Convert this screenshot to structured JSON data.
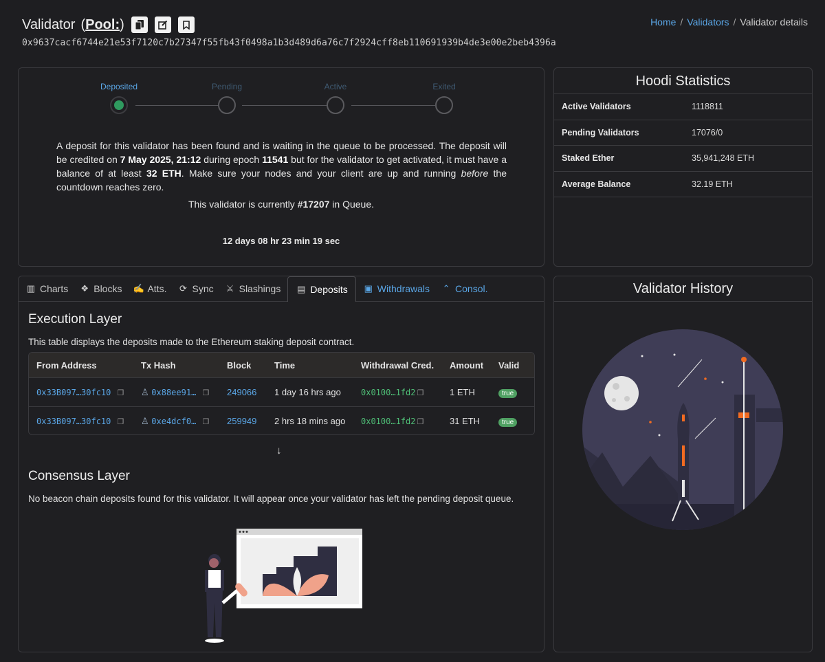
{
  "header": {
    "title": "Validator",
    "pool_prefix": "(",
    "pool_label": "Pool:",
    "pool_suffix": ")",
    "pubkey": "0x9637cacf6744e21e53f7120c7b27347f55fb43f0498a1b3d489d6a76c7f2924cff8eb110691939b4de3e00e2beb4396a"
  },
  "breadcrumb": {
    "home": "Home",
    "validators": "Validators",
    "current": "Validator details",
    "sep": "/"
  },
  "steps": [
    {
      "label": "Deposited",
      "state": "done",
      "color": "#5aa6e6"
    },
    {
      "label": "Pending",
      "state": "todo",
      "color": "#3f5a72"
    },
    {
      "label": "Active",
      "state": "todo",
      "color": "#3f5a72"
    },
    {
      "label": "Exited",
      "state": "todo",
      "color": "#3f5a72"
    }
  ],
  "status": {
    "t1": "A deposit for this validator has been found and is waiting in the queue to be processed. The deposit will be credited on ",
    "date": "7 May 2025, 21:12",
    "t2": " during epoch ",
    "epoch": "11541",
    "t3": " but for the validator to get activated, it must have a balance of at least ",
    "min_balance": "32 ETH",
    "t4": ". Make sure your nodes and your client are up and running ",
    "emph": "before",
    "t5": " the countdown reaches zero.",
    "queue_prefix": "This validator is currently ",
    "queue_pos": "#17207",
    "queue_suffix": " in Queue.",
    "countdown": "12 days 08 hr 23 min 19 sec"
  },
  "stats": {
    "title": "Hoodi Statistics",
    "rows": [
      {
        "label": "Active Validators",
        "value": "1118811"
      },
      {
        "label": "Pending Validators",
        "value": "17076/0"
      },
      {
        "label": "Staked Ether",
        "value": "35,941,248 ETH"
      },
      {
        "label": "Average Balance",
        "value": "32.19 ETH"
      }
    ]
  },
  "tabs": [
    {
      "label": "Charts",
      "icon": "chart-icon"
    },
    {
      "label": "Blocks",
      "icon": "cubes-icon"
    },
    {
      "label": "Atts.",
      "icon": "signature-icon"
    },
    {
      "label": "Sync",
      "icon": "sync-icon"
    },
    {
      "label": "Slashings",
      "icon": "slashing-icon"
    },
    {
      "label": "Deposits",
      "icon": "deposit-icon"
    },
    {
      "label": "Withdrawals",
      "icon": "money-icon"
    },
    {
      "label": "Consol.",
      "icon": "chevron-up-icon"
    }
  ],
  "execution": {
    "title": "Execution Layer",
    "desc": "This table displays the deposits made to the Ethereum staking deposit contract.",
    "columns": [
      "From Address",
      "Tx Hash",
      "Block",
      "Time",
      "Withdrawal Cred.",
      "Amount",
      "Valid"
    ],
    "rows": [
      {
        "from": "0x33B097…30fc10",
        "tx": "0x88ee91…",
        "block": "249066",
        "time": "1 day 16 hrs ago",
        "cred": "0x0100…1fd2",
        "amount": "1 ETH",
        "valid": "true"
      },
      {
        "from": "0x33B097…30fc10",
        "tx": "0xe4dcf0…",
        "block": "259949",
        "time": "2 hrs 18 mins ago",
        "cred": "0x0100…1fd2",
        "amount": "31 ETH",
        "valid": "true"
      }
    ]
  },
  "consensus": {
    "title": "Consensus Layer",
    "desc": "No beacon chain deposits found for this validator. It will appear once your validator has left the pending deposit queue."
  },
  "history": {
    "title": "Validator History"
  }
}
